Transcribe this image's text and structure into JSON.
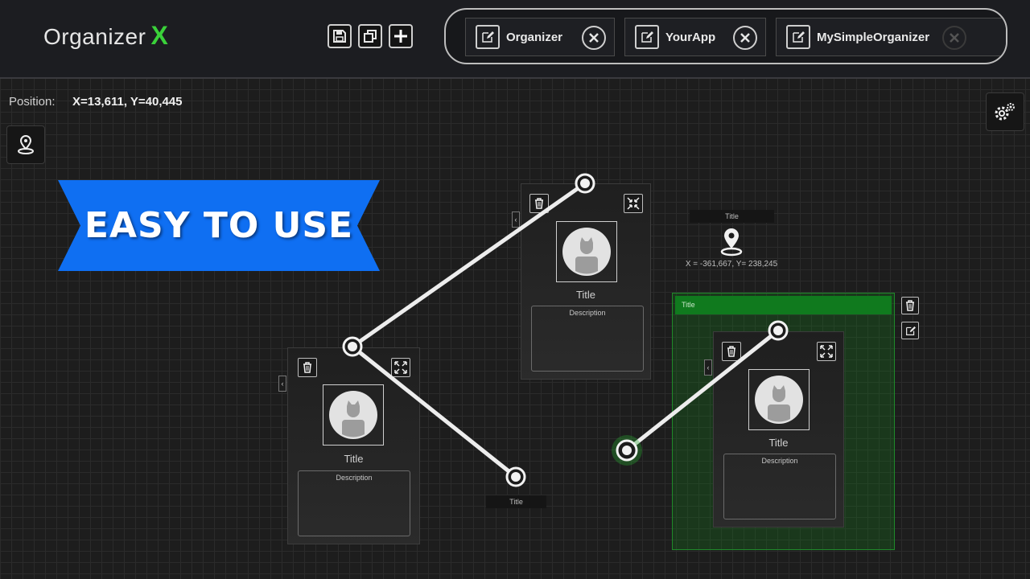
{
  "app": {
    "title": "Organizer",
    "title_mark": "X",
    "accent_color": "#3ad13a"
  },
  "toolbar": {
    "buttons": [
      {
        "icon": "save-icon"
      },
      {
        "icon": "copy-icon"
      },
      {
        "icon": "plus-icon"
      }
    ]
  },
  "tabs": [
    {
      "label": "Organizer",
      "edit_icon": "edit-icon",
      "close_icon": "close-icon"
    },
    {
      "label": "YourApp",
      "edit_icon": "edit-icon",
      "close_icon": "close-icon"
    },
    {
      "label": "MySimpleOrganizer",
      "edit_icon": "edit-icon",
      "close_icon": "close-icon"
    }
  ],
  "status": {
    "position_label": "Position:",
    "position_value": "X=13,611, Y=40,445"
  },
  "banner": {
    "text": "EASY TO USE",
    "color": "#0f6ff2"
  },
  "cards": [
    {
      "title": "Title",
      "description": "Description"
    },
    {
      "title": "Title",
      "description": "Description"
    },
    {
      "title": "Title",
      "description": "Description"
    }
  ],
  "nodes": [
    {
      "label": "Title"
    }
  ],
  "marker": {
    "label": "Title",
    "coords": "X = -361,667, Y= 238,245"
  },
  "group": {
    "title": "Title",
    "color": "#107a1e"
  }
}
